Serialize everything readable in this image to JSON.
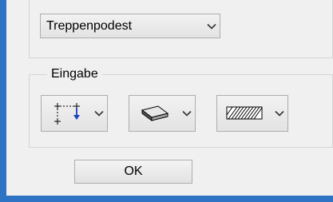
{
  "dialog": {
    "stair_type_select": {
      "value": "Treppenpodest",
      "icon": "chevron-down-icon"
    },
    "input_group": {
      "legend": "Eingabe",
      "combos": [
        {
          "icon": "corner-placement-icon"
        },
        {
          "icon": "slab-block-icon"
        },
        {
          "icon": "hatch-pattern-icon"
        }
      ]
    },
    "ok_label": "OK"
  },
  "colors": {
    "window_frame": "#2f74c4",
    "dialog_background": "#f0f0f0",
    "control_border": "#adadad"
  }
}
